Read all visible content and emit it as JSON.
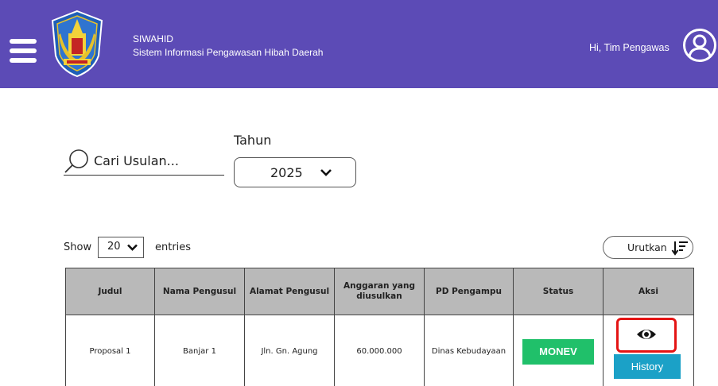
{
  "header": {
    "app_name": "SIWAHID",
    "app_subtitle": "Sistem Informasi Pengawasan Hibah Daerah",
    "greeting": "Hi, Tim Pengawas",
    "icons": {
      "menu": "hamburger-menu-icon",
      "logo": "provincial-emblem-logo",
      "user": "user-avatar-icon"
    },
    "colors": {
      "bar": "#5c4bb6",
      "text": "#ffffff"
    }
  },
  "filters": {
    "search_placeholder": "Cari Usulan...",
    "year_label": "Tahun",
    "year_value": "2025"
  },
  "table_controls": {
    "show_label": "Show",
    "entries_value": "20",
    "entries_label": "entries",
    "sort_label": "Urutkan"
  },
  "table": {
    "columns": [
      "Judul",
      "Nama Pengusul",
      "Alamat Pengusul",
      "Anggaran yang diusulkan",
      "PD Pengampu",
      "Status",
      "Aksi"
    ],
    "rows": [
      {
        "judul": "Proposal 1",
        "nama": "Banjar 1",
        "alamat": "Jln. Gn. Agung",
        "anggaran": "60.000.000",
        "pd_pengampu": "Dinas Kebudayaan",
        "status": "MONEV",
        "action_history": "History"
      }
    ],
    "colors": {
      "header_bg": "#b9b9b9",
      "status_green": "#20c06a",
      "history_blue": "#1ba1c7",
      "highlight_red": "#e41414"
    }
  }
}
